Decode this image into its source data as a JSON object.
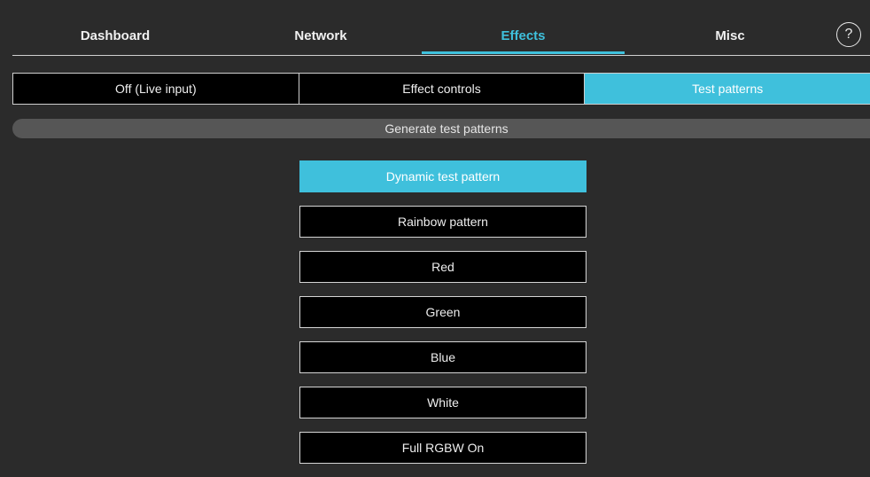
{
  "nav": {
    "tabs": [
      {
        "label": "Dashboard"
      },
      {
        "label": "Network"
      },
      {
        "label": "Effects",
        "active": true
      },
      {
        "label": "Misc"
      }
    ],
    "help_symbol": "?"
  },
  "mode": {
    "options": [
      {
        "label": "Off (Live input)"
      },
      {
        "label": "Effect controls"
      },
      {
        "label": "Test patterns",
        "active": true
      }
    ]
  },
  "section": {
    "title": "Generate test patterns"
  },
  "patterns": [
    {
      "label": "Dynamic test pattern",
      "active": true
    },
    {
      "label": "Rainbow pattern"
    },
    {
      "label": "Red"
    },
    {
      "label": "Green"
    },
    {
      "label": "Blue"
    },
    {
      "label": "White"
    },
    {
      "label": "Full RGBW On"
    }
  ],
  "colors": {
    "accent": "#3fc0dc",
    "background": "#2b2b2b",
    "button": "#000000"
  },
  "icons": {
    "help": "help-circle-icon"
  }
}
